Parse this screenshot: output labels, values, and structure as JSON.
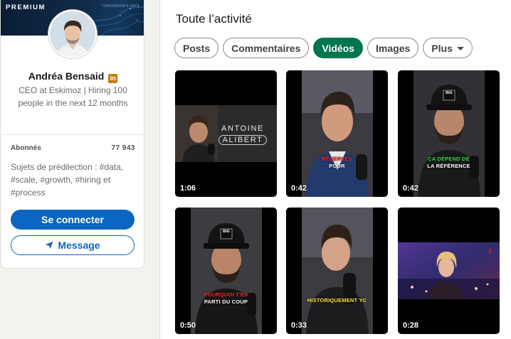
{
  "profile": {
    "banner_label": "PREMIUM",
    "banner_small": "TOMORROW'S DATA",
    "name": "Andréa Bensaid",
    "badge": "in",
    "headline": "CEO at Eskimoz | Hiring 100 people in the next 12 months",
    "followers_label": "Abonnés",
    "followers_count": "77 943",
    "topics": "Sujets de prédilection : #data, #scale, #growth, #hiring et #process",
    "connect_label": "Se connecter",
    "message_label": "Message"
  },
  "activity": {
    "title": "Toute l’activité",
    "filters": [
      {
        "label": "Posts",
        "active": false
      },
      {
        "label": "Commentaires",
        "active": false
      },
      {
        "label": "Vidéos",
        "active": true
      },
      {
        "label": "Images",
        "active": false
      },
      {
        "label": "Plus",
        "active": false
      }
    ]
  },
  "videos": [
    {
      "duration": "1:06",
      "overlay_line1": "ANTOINE",
      "overlay_line2": "ALIBERT"
    },
    {
      "duration": "0:42",
      "caption_top": "RÉSERVÉS",
      "caption_bottom": "POUR"
    },
    {
      "duration": "0:42",
      "caption_top": "ÇA DÉPEND DE",
      "caption_bottom": "LA RÉFÉRENCE",
      "logo": "BIG"
    },
    {
      "duration": "0:50",
      "caption_top": "POURQUOI T'ES",
      "caption_bottom": "PARTI DU COUP",
      "logo": "BIG"
    },
    {
      "duration": "0:33",
      "caption_top": "HISTORIQUEMENT YC"
    },
    {
      "duration": "0:28",
      "channel": "2"
    }
  ],
  "colors": {
    "linkedin_blue": "#0a66c2",
    "active_pill": "#01754f",
    "premium_gold": "#c37d16"
  },
  "icons": {
    "message": "send-icon",
    "more": "caret-down-icon"
  }
}
